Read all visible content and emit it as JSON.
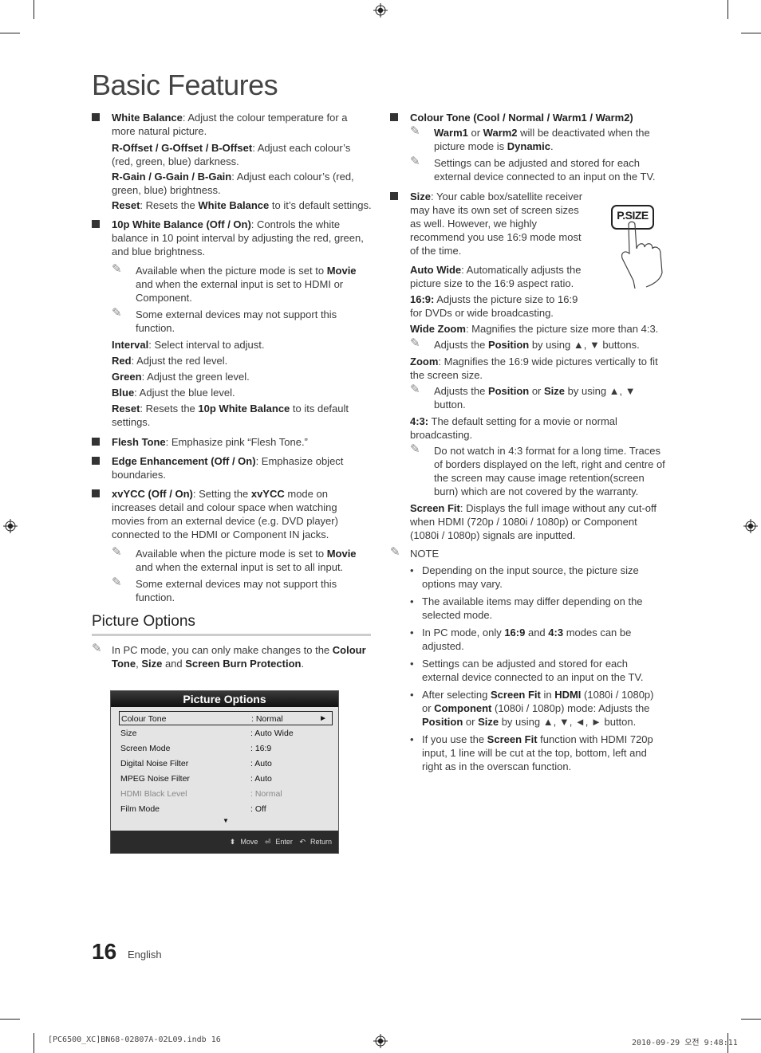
{
  "page": {
    "title": "Basic Features",
    "page_number": "16",
    "language": "English",
    "slug_left": "[PC6500_XC]BN68-02807A-02L09.indb   16",
    "slug_right": "2010-09-29   오전 9:48:11"
  },
  "left": {
    "wb_head": "White Balance",
    "wb_text": ": Adjust the colour temperature for a more natural picture.",
    "roffset_head": "R-Offset / G-Offset / B-Offset",
    "roffset_text": ": Adjust each colour’s (red, green, blue) darkness.",
    "rgain_head": "R-Gain / G-Gain / B-Gain",
    "rgain_text": ": Adjust each colour’s (red, green, blue) brightness.",
    "reset1_head": "Reset",
    "reset1_text_a": ": Resets the ",
    "reset1_bold": "White Balance",
    "reset1_text_b": " to it’s default settings.",
    "tenp_head": "10p White Balance (Off / On)",
    "tenp_text": ": Controls the white balance in 10 point interval by adjusting the red, green, and blue brightness.",
    "tenp_note1_a": "Available when the picture mode is set to ",
    "tenp_note1_bold": "Movie",
    "tenp_note1_b": " and when the external input is set to HDMI or Component.",
    "tenp_note2": "Some external devices may not support this function.",
    "interval_head": "Interval",
    "interval_text": ": Select interval to adjust.",
    "red_head": "Red",
    "red_text": ": Adjust the red level.",
    "green_head": "Green",
    "green_text": ": Adjust the green level.",
    "blue_head": "Blue",
    "blue_text": ": Adjust the blue level.",
    "reset2_head": "Reset",
    "reset2_text_a": ": Resets the ",
    "reset2_bold": "10p White Balance",
    "reset2_text_b": " to its default settings.",
    "flesh_head": "Flesh Tone",
    "flesh_text": ": Emphasize pink “Flesh Tone.”",
    "edge_head": "Edge Enhancement (Off / On)",
    "edge_text": ": Emphasize object boundaries.",
    "xv_head": "xvYCC (Off / On)",
    "xv_text_a": ": Setting the ",
    "xv_bold": "xvYCC",
    "xv_text_b": " mode on increases detail and colour space when watching movies from an external device (e.g. DVD player) connected to the HDMI or Component IN jacks.",
    "xv_note1_a": "Available when the picture mode is set to ",
    "xv_note1_bold": "Movie",
    "xv_note1_b": " and when the external input is set to all input.",
    "xv_note2": "Some external devices may not support this function."
  },
  "picture_options": {
    "heading": "Picture Options",
    "note_a": "In PC mode, you can only make changes to the ",
    "note_b1": "Colour Tone",
    "note_c": ", ",
    "note_b2": "Size",
    "note_d": " and ",
    "note_b3": "Screen Burn Protection",
    "note_e": "."
  },
  "osd": {
    "title": "Picture Options",
    "rows": [
      {
        "label": "Colour Tone",
        "value": ": Normal"
      },
      {
        "label": "Size",
        "value": ": Auto Wide"
      },
      {
        "label": "Screen Mode",
        "value": ": 16:9"
      },
      {
        "label": "Digital Noise Filter",
        "value": ": Auto"
      },
      {
        "label": "MPEG Noise Filter",
        "value": ": Auto"
      },
      {
        "label": "HDMI Black Level",
        "value": ": Normal"
      },
      {
        "label": "Film Mode",
        "value": ": Off"
      }
    ],
    "more_arrow": "▼",
    "selected_arrow": "►",
    "move_icon": "⬍",
    "move": "Move",
    "enter_icon": "⏎",
    "enter": "Enter",
    "return_icon": "↶",
    "return": "Return"
  },
  "right": {
    "ct_head": "Colour Tone (Cool / Normal / Warm1 / Warm2)",
    "ct_note1_b1": "Warm1",
    "ct_note1_a": " or ",
    "ct_note1_b2": "Warm2",
    "ct_note1_c": " will be deactivated when the picture mode is ",
    "ct_note1_b3": "Dynamic",
    "ct_note1_d": ".",
    "ct_note2": "Settings can be adjusted and stored for each external device connected to an input on the TV.",
    "size_head": "Size",
    "size_text": ": Your cable box/satellite receiver may have its own set of screen sizes as well. However, we highly recommend you use 16:9 mode most of the time.",
    "psize_label": "P.SIZE",
    "autowide_head": "Auto Wide",
    "autowide_text": ": Automatically adjusts the picture size to the 16:9 aspect ratio.",
    "r169_head": "16:9:",
    "r169_text": " Adjusts the picture size to 16:9 for DVDs or wide broadcasting.",
    "widezoom_head": "Wide Zoom",
    "widezoom_text": ": Magnifies the picture size more than 4:3.",
    "widezoom_note_a": "Adjusts the ",
    "widezoom_note_bold": "Position",
    "widezoom_note_b": " by using ▲, ▼ buttons.",
    "zoom_head": "Zoom",
    "zoom_text": ": Magnifies the 16:9 wide pictures vertically to fit the screen size.",
    "zoom_note_a": "Adjusts the ",
    "zoom_note_b1": "Position",
    "zoom_note_b": " or ",
    "zoom_note_b2": "Size",
    "zoom_note_c": " by using ▲, ▼ button.",
    "r43_head": "4:3:",
    "r43_text": " The default setting for a movie or normal broadcasting.",
    "r43_note": "Do not watch in 4:3 format for a long time. Traces of borders displayed on the left, right and centre of the screen may cause image retention(screen burn) which are not covered by the warranty.",
    "fit_head": "Screen Fit",
    "fit_text": ": Displays the full image without any cut-off when HDMI (720p / 1080i / 1080p) or Component (1080i / 1080p) signals are inputted.",
    "note_label": "NOTE",
    "notes": [
      "Depending on the input source, the picture size options may vary.",
      "The available items may differ depending on the selected mode."
    ],
    "note3_a": "In PC mode, only ",
    "note3_b1": "16:9",
    "note3_b": " and ",
    "note3_b2": "4:3",
    "note3_c": " modes can be adjusted.",
    "note4": "Settings can be adjusted and stored for each external device connected to an input on the TV.",
    "note5_a": "After selecting ",
    "note5_b1": "Screen Fit",
    "note5_b": " in ",
    "note5_b2": "HDMI",
    "note5_c": " (1080i / 1080p) or ",
    "note5_b3": "Component",
    "note5_d": " (1080i / 1080p) mode: Adjusts the ",
    "note5_b4": "Position",
    "note5_e": " or ",
    "note5_b5": "Size",
    "note5_f": " by using ▲, ▼, ◄, ► button.",
    "note6_a": "If you use the ",
    "note6_b1": "Screen Fit",
    "note6_b": " function with HDMI 720p input, 1 line will be cut at the top, bottom, left and right as in the overscan function."
  },
  "icons": {
    "pen": "✎",
    "registration": "registration-mark"
  }
}
